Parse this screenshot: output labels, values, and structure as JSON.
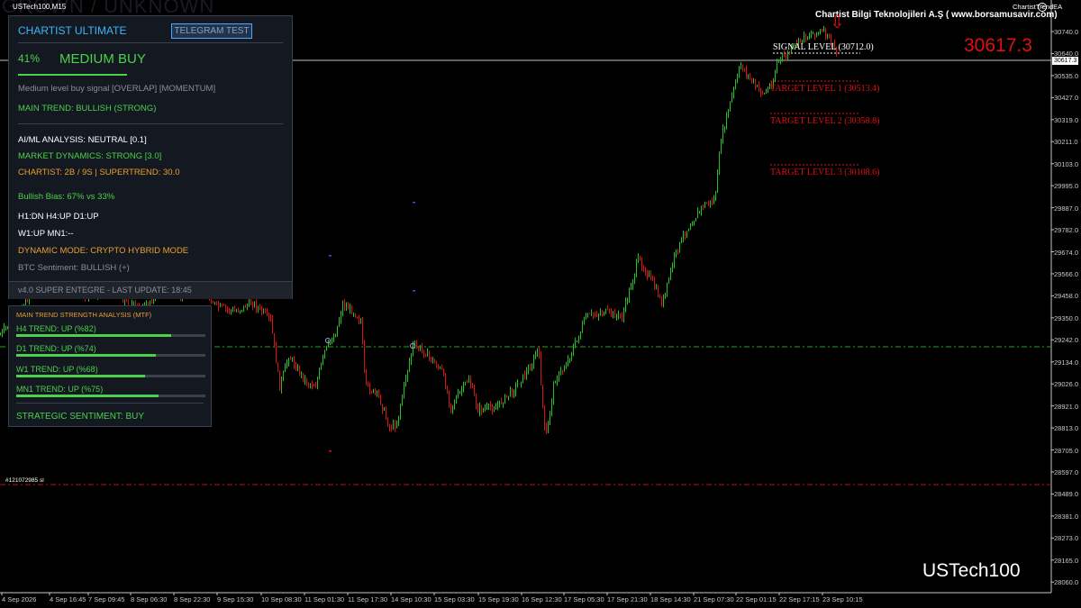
{
  "window": {
    "symbol_tf": "USTech100,M15",
    "ea_name": "ChartistTrendEA",
    "watermark": "GROWN / UNKNOWN"
  },
  "company": "Chartist Bilgi Teknolojileri A.Ş ( www.borsamusavir.com)",
  "current_price_large": "30617.3",
  "price_box": "30617.3",
  "symbol_label": "USTech100",
  "order_label": "#121072985 sl",
  "levels": {
    "signal": "SIGNAL LEVEL (30712.0)",
    "t1": "TARGET LEVEL 1 (30513.4)",
    "t2": "TARGET LEVEL 2 (30358.8)",
    "t3": "TARGET LEVEL 3 (30108.6)"
  },
  "y_axis": [
    "30740.0",
    "30640.0",
    "30535.0",
    "30427.0",
    "30319.0",
    "30211.0",
    "30103.0",
    "29995.0",
    "29887.0",
    "29782.0",
    "29674.0",
    "29566.0",
    "29458.0",
    "29350.0",
    "29242.0",
    "29134.0",
    "29026.0",
    "28921.0",
    "28813.0",
    "28705.0",
    "28597.0",
    "28489.0",
    "28381.0",
    "28273.0",
    "28165.0",
    "28060.0"
  ],
  "x_axis": [
    "4 Sep 2026",
    "4 Sep 16:45",
    "7 Sep 09:45",
    "8 Sep 06:30",
    "8 Sep 22:30",
    "9 Sep 15:30",
    "10 Sep 08:30",
    "11 Sep 01:30",
    "11 Sep 17:30",
    "14 Sep 10:30",
    "15 Sep 03:30",
    "15 Sep 19:30",
    "16 Sep 12:30",
    "17 Sep 05:30",
    "17 Sep 21:30",
    "18 Sep 14:30",
    "21 Sep 07:30",
    "22 Sep 01:15",
    "22 Sep 17:15",
    "23 Sep 10:15"
  ],
  "panel1": {
    "title": "CHARTIST ULTIMATE",
    "telegram_button": "TELEGRAM TEST",
    "signal_pct": "41%",
    "signal_pct_value": 0.41,
    "signal_label": "MEDIUM BUY",
    "signal_desc": "Medium level buy signal [OVERLAP] [MOMENTUM]",
    "main_trend": "MAIN TREND: BULLISH (STRONG)",
    "ai_ml": "AI/ML ANALYSIS: NEUTRAL [0.1]",
    "market_dynamics": "MARKET DYNAMICS: STRONG [3.0]",
    "chartist": "CHARTIST: 2B / 9S | SUPERTREND: 30.0",
    "bullish_bias": "Bullish Bias: 67% vs 33%",
    "tf_line1": "H1:DN H4:UP D1:UP",
    "tf_line2": "W1:UP MN1:--",
    "dynamic_mode": "DYNAMIC MODE: CRYPTO HYBRID MODE",
    "btc_sentiment": "BTC Sentiment: BULLISH (+)",
    "footer": "v4.0 SUPER ENTEGRE - LAST UPDATE: 18:45"
  },
  "panel2": {
    "title": "MAIN TREND STRENGTH ANALYSIS (MTF)",
    "rows": [
      {
        "label": "H4 TREND: UP (%82)",
        "value": 0.82
      },
      {
        "label": "D1 TREND: UP (%74)",
        "value": 0.74
      },
      {
        "label": "W1 TREND: UP (%68)",
        "value": 0.68
      },
      {
        "label": "MN1 TREND: UP (%75)",
        "value": 0.75
      }
    ],
    "sentiment": "STRATEGIC SENTIMENT: BUY"
  },
  "colors": {
    "bull": "#22c422",
    "bear": "#e01010",
    "level_red": "#e01010",
    "panel_green": "#4cd14c",
    "accent_blue": "#3ab7ff",
    "orange": "#e8a030"
  }
}
